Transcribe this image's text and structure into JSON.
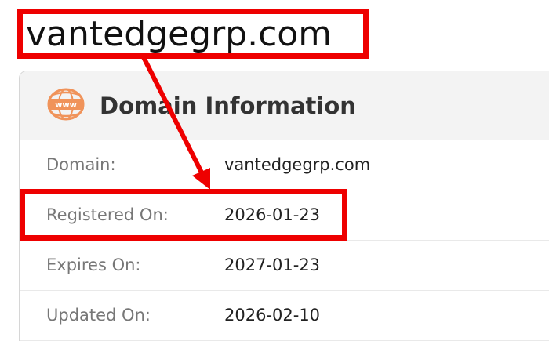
{
  "page": {
    "domain_heading": "vantedgegrp.com"
  },
  "card": {
    "icon": "www-globe-icon",
    "icon_text": "www",
    "title": "Domain Information",
    "rows": [
      {
        "label": "Domain:",
        "value": "vantedgegrp.com"
      },
      {
        "label": "Registered On:",
        "value": "2026-01-23"
      },
      {
        "label": "Expires On:",
        "value": "2027-01-23"
      },
      {
        "label": "Updated On:",
        "value": "2026-02-10"
      }
    ]
  },
  "annotations": {
    "highlight_color": "#ee0000",
    "icon_color": "#f0935a"
  }
}
